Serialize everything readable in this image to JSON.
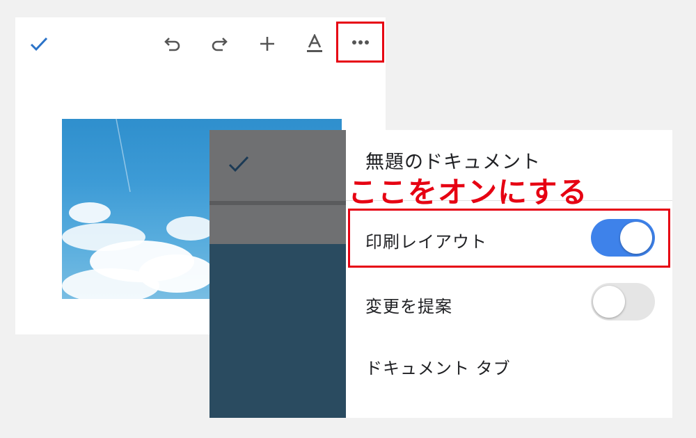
{
  "back_screen": {
    "toolbar": {
      "icons": [
        "check-icon",
        "undo-icon",
        "redo-icon",
        "add-icon",
        "text-format-icon",
        "more-icon"
      ]
    }
  },
  "front_screen": {
    "panel": {
      "title": "無題のドキュメント",
      "items": [
        {
          "label": "印刷レイアウト",
          "toggle_on": true
        },
        {
          "label": "変更を提案",
          "toggle_on": false
        },
        {
          "label": "ドキュメント タブ"
        }
      ]
    }
  },
  "annotation": {
    "text": "ここをオンにする",
    "color": "#e60012"
  },
  "colors": {
    "accent": "#3e82ea",
    "highlight": "#e60012",
    "icon": "#555555",
    "check": "#2b73c8"
  }
}
